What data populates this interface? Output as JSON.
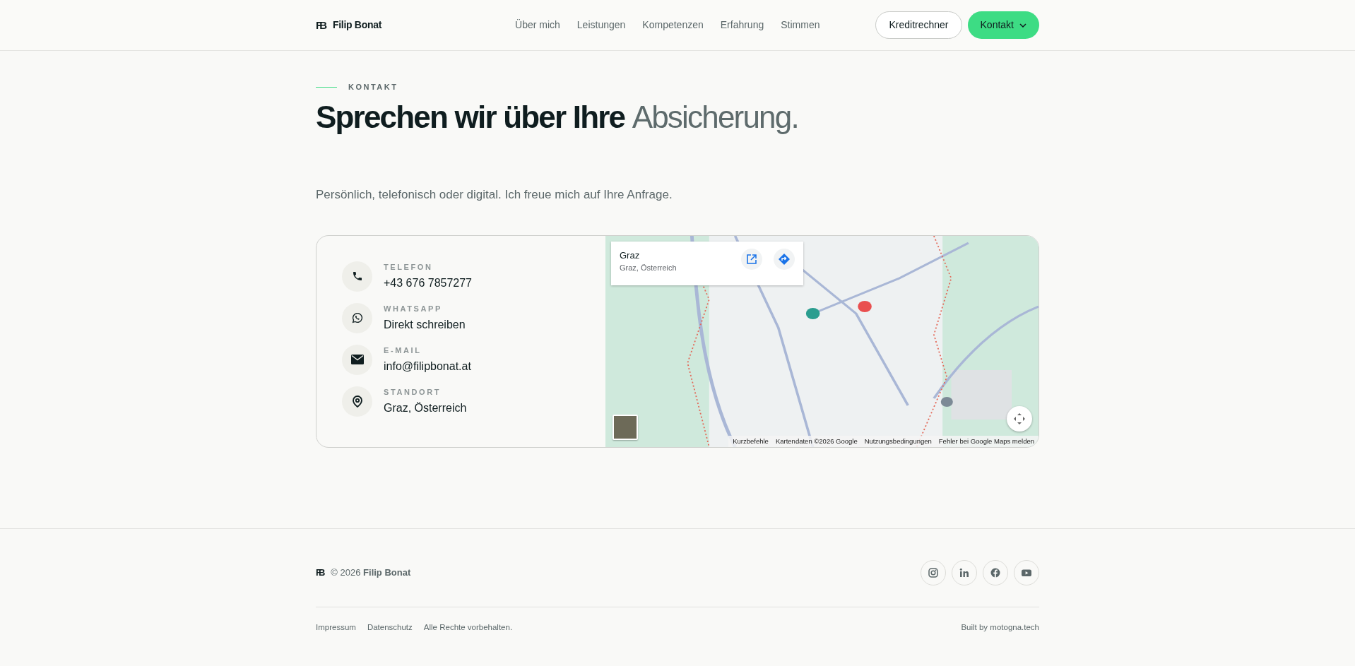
{
  "brand": {
    "logo": "FB",
    "name": "Filip Bonat"
  },
  "nav": [
    {
      "label": "Über mich"
    },
    {
      "label": "Leistungen"
    },
    {
      "label": "Kompetenzen"
    },
    {
      "label": "Erfahrung"
    },
    {
      "label": "Stimmen"
    }
  ],
  "header_buttons": {
    "secondary": "Kreditrechner",
    "primary": "Kontakt"
  },
  "section": {
    "kicker": "KONTAKT",
    "heading": {
      "text": "Sprechen wir über Ihre",
      "accent": "Absicherung."
    },
    "intro": "Persönlich, telefonisch oder digital. Ich freue mich auf Ihre Anfrage."
  },
  "contacts": [
    {
      "kind": "phone",
      "label": "TELEFON",
      "value": "+43 676 7857277"
    },
    {
      "kind": "whatsapp",
      "label": "WHATSAPP",
      "value": "Direkt schreiben"
    },
    {
      "kind": "email",
      "label": "E-MAIL",
      "value": "info@filipbonat.at"
    },
    {
      "kind": "location",
      "label": "STANDORT",
      "value": "Graz, Österreich"
    }
  ],
  "map": {
    "place_title": "Graz",
    "place_address": "Graz, Österreich",
    "attribution": [
      "Kurzbefehle",
      "Kartendaten ©2026 Google",
      "Nutzungsbedingungen",
      "Fehler bei Google Maps melden"
    ]
  },
  "footer": {
    "logo": "FB",
    "copyright": "© 2026 **Filip Bonat**",
    "links": [
      "Impressum",
      "Datenschutz"
    ],
    "rights": "Alle Rechte vorbehalten.",
    "credit": "Built by motogna.tech"
  }
}
